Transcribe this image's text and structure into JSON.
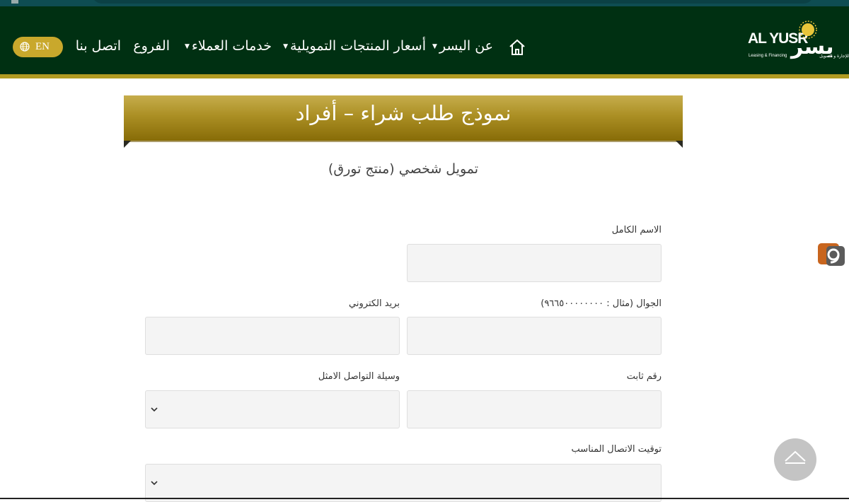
{
  "header": {
    "logo": {
      "brand_en": "AL YUSR",
      "tagline_en": "Leasing & Financing",
      "brand_ar": "يسر",
      "tagline_ar": "للإجارة و التمويل"
    },
    "nav": [
      {
        "label": "عن اليسر",
        "dropdown": true
      },
      {
        "label": "أسعار المنتجات التمويلية",
        "dropdown": true
      },
      {
        "label": "خدمات العملاء",
        "dropdown": true
      },
      {
        "label": "الفروع",
        "dropdown": false
      },
      {
        "label": "اتصل بنا",
        "dropdown": false
      }
    ],
    "home_icon": "home-icon",
    "language_button": {
      "label": "EN",
      "icon": "globe-icon"
    }
  },
  "page": {
    "title": "نموذج طلب شراء – أفراد",
    "subtitle": "تمويل شخصي (منتج تورق)"
  },
  "form": {
    "full_name_label": "الاسم الكامل",
    "mobile_label": "الجوال (مثال : ٩٦٦٥٠٠٠٠٠٠٠٠)",
    "email_label": "بريد الكتروني",
    "landline_label": "رقم ثابت",
    "contact_method_label": "وسيلة التواصل الامثل",
    "contact_time_label": "توقيت الاتصال المناسب"
  },
  "colors": {
    "header_bg": "#003012",
    "gold": "#b19b22",
    "banner_gold": "#ab8f24"
  }
}
